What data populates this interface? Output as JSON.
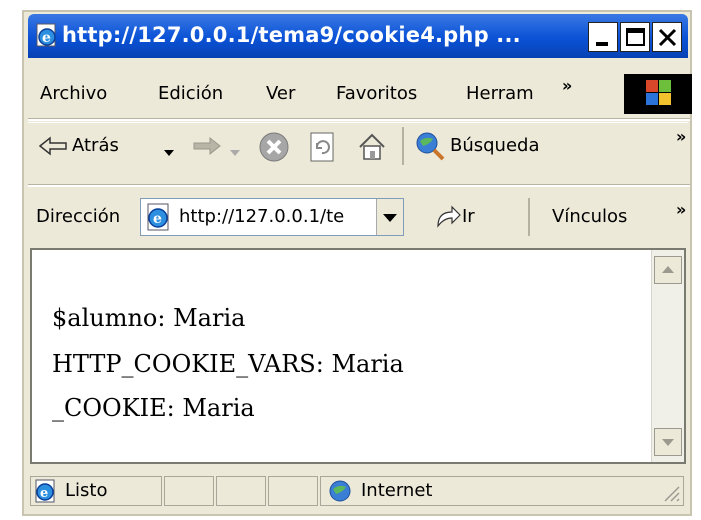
{
  "window": {
    "title": "http://127.0.0.1/tema9/cookie4.php ...",
    "buttons": {
      "minimize": "minimize",
      "maximize": "maximize",
      "close": "close"
    }
  },
  "menubar": {
    "items": [
      "Archivo",
      "Edición",
      "Ver",
      "Favoritos",
      "Herram"
    ],
    "overflow": "»"
  },
  "toolbar": {
    "back_label": "Atrás",
    "search_label": "Búsqueda",
    "overflow": "»",
    "icons": [
      "back-arrow-icon",
      "dropdown-arrow-icon",
      "forward-arrow-icon",
      "stop-icon",
      "refresh-icon",
      "home-icon",
      "search-globe-icon"
    ]
  },
  "addressbar": {
    "label": "Dirección",
    "value": "http://127.0.0.1/te",
    "go_label": "Ir",
    "links_label": "Vínculos",
    "overflow": "»"
  },
  "content": {
    "lines": [
      "$alumno: Maria",
      "HTTP_COOKIE_VARS: Maria",
      "_COOKIE: Maria"
    ]
  },
  "statusbar": {
    "status": "Listo",
    "zone": "Internet"
  },
  "colors": {
    "titlebar": "#0a52d6",
    "chrome": "#ece9d8",
    "close_x": "#000000"
  }
}
